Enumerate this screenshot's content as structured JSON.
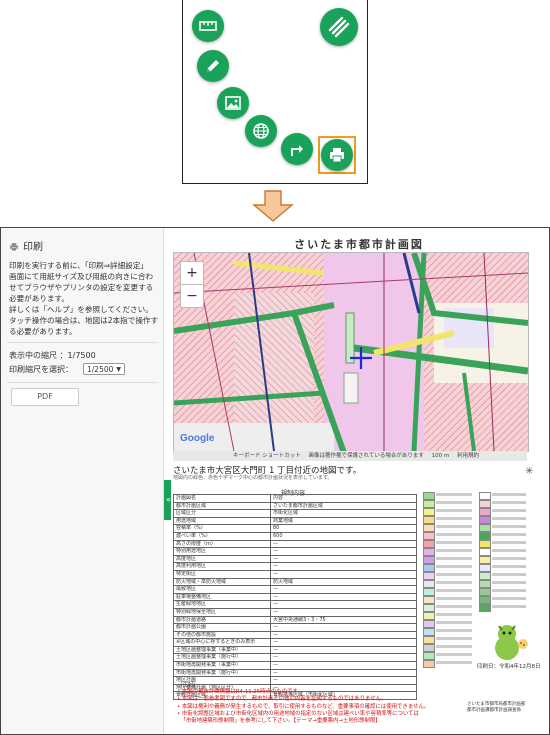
{
  "print_panel": {
    "title": "印刷",
    "instructions": [
      "印刷を実行する前に、「印刷⇒詳細設定」",
      "画面にて用紙サイズ及び用紙の向きに合わ",
      "せてブラウザやプリンタの設定を変更する",
      "必要があります。",
      "詳しくは「ヘルプ」を参照してください。",
      "タッチ操作の場合は、地図は2本指で操作す",
      "る必要があります。"
    ],
    "display_scale_label": "表示中の縮尺",
    "display_scale_value": "：1/7500",
    "print_scale_label": "印刷縮尺を選択：",
    "print_scale_value": "1/2500",
    "pdf_button": "PDF",
    "collapse_glyph": "«"
  },
  "radial_menu": {
    "icons": [
      "ruler-icon",
      "pencil-icon",
      "image-icon",
      "globe-icon",
      "route-arrow-icon",
      "printer-icon",
      "menu-icon"
    ],
    "highlight_color": "#f29a1a",
    "button_color": "#1aa15a"
  },
  "paper": {
    "title": "さいたま市都市計画図",
    "zoom_in": "+",
    "zoom_out": "−",
    "google": "Google",
    "map_footer": [
      "キーボード ショートカット",
      "画像は著作権で保護されている場合があります",
      "100 m",
      "利用規約"
    ],
    "address": "さいたま市大宮区大門町 1 丁目付近の地図です。",
    "address_sub": "地図内の緑色、赤色十字マーク中心の都市計画状況を表示しています。",
    "compass": "✳",
    "legend_header": "規制内容",
    "table_rows": [
      [
        "計画図名",
        "内容"
      ],
      [
        "都市計画区域",
        "さいたま都市計画区域"
      ],
      [
        "区域区分",
        "市街化区域"
      ],
      [
        "用途地域",
        "商業地域"
      ],
      [
        "容積率（%）",
        "80"
      ],
      [
        "建ぺい率（%）",
        "600"
      ],
      [
        "高さの限度（m）",
        "—"
      ],
      [
        "特別用途地区",
        "—"
      ],
      [
        "高度地区",
        "—"
      ],
      [
        "高度利用地区",
        "—"
      ],
      [
        "特定街区",
        "—"
      ],
      [
        "防火地域・準防火地域",
        "防火地域"
      ],
      [
        "風致地区",
        "—"
      ],
      [
        "駐車場整備地区",
        "—"
      ],
      [
        "生産緑地地区",
        "—"
      ],
      [
        "特別緑地保全地区",
        "—"
      ],
      [
        "都市計画道路",
        "大宮中央通線3・3・75"
      ],
      [
        "都市計画公園",
        "—"
      ],
      [
        "その他の都市施設",
        "—"
      ],
      [
        "※区域の中心に存するときのみ表示",
        "—"
      ],
      [
        "土地区画整理事業（事業中）",
        "—"
      ],
      [
        "土地区画整理事業（施行中）",
        "—"
      ],
      [
        "市街地再開発事業（事業中）",
        "—"
      ],
      [
        "市街地再開発事業（施行中）",
        "—"
      ],
      [
        "地区計画",
        "—"
      ],
      [
        "地区整備計画（地区区分）",
        "—"
      ],
      [
        "景観計画区域",
        "景観誘導区域（市街化区域）"
      ]
    ],
    "print_date": "印刷日：令和4年12月8日",
    "notes_header": "（注記）",
    "notes": [
      "本図の都市計画情報はR4.11.25時点のものです。",
      "本図は一般参考図ですので、都市計画その他の内容を証明するものではありません。",
      "本図は権利や義務が発生するもので、取引に使用するものなど、重要事項の確認には使用できません。",
      "市街化調整区域および市街化区域内の用途地域の指定のない区域は建ぺい率や容積率等については",
      "「市街地建築形態制限」を参考にして下さい。【テーマ→重要案内→土地形態制限】"
    ],
    "org_lines": [
      "さいたま市都市局都市計画部",
      "都市計画課都市計画調査係"
    ]
  }
}
